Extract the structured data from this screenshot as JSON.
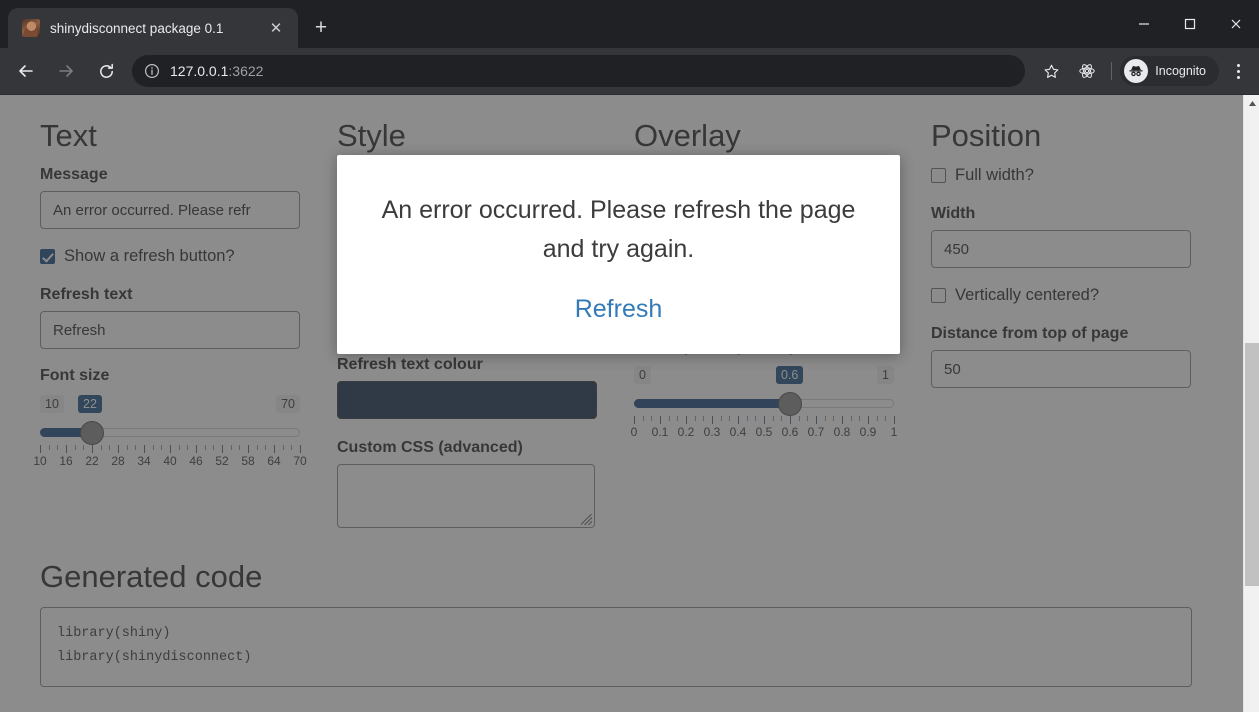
{
  "browser": {
    "tab": {
      "title": "shinydisconnect package 0.1",
      "favicon_name": "profile-photo-favicon",
      "close_label": "✕"
    },
    "new_tab_label": "+",
    "window_controls": {
      "minimize": "minimize",
      "maximize": "maximize",
      "close": "close"
    },
    "nav": {
      "back": "back",
      "forward": "forward",
      "reload": "reload"
    },
    "omnibox": {
      "host": "127.0.0.1",
      "port": ":3622",
      "site_info_icon": "info-circle-icon"
    },
    "toolbar": {
      "bookmark_icon": "star-icon",
      "extension_icon": "react-extension-icon",
      "incognito_label": "Incognito",
      "menu_icon": "kebab-menu-icon"
    }
  },
  "page": {
    "columns": {
      "text": {
        "heading": "Text",
        "message_label": "Message",
        "message_value": "An error occurred. Please refr",
        "show_refresh_label": "Show a refresh button?",
        "show_refresh_checked": true,
        "refresh_text_label": "Refresh text",
        "refresh_text_value": "Refresh",
        "font_size_label": "Font size"
      },
      "style": {
        "heading": "Style",
        "refresh_colour_label": "Refresh text colour",
        "refresh_colour_value": "#1a3450",
        "custom_css_label": "Custom CSS (advanced)",
        "custom_css_value": ""
      },
      "overlay": {
        "heading": "Overlay",
        "transparency_label": "Overlay transparency"
      },
      "position": {
        "heading": "Position",
        "full_width_label": "Full width?",
        "full_width_checked": false,
        "width_label": "Width",
        "width_value": "450",
        "vertically_centered_label": "Vertically centered?",
        "vertically_centered_checked": false,
        "distance_top_label": "Distance from top of page",
        "distance_top_value": "50"
      }
    },
    "generated_code": {
      "heading": "Generated code",
      "code": "library(shiny)\nlibrary(shinydisconnect)"
    }
  },
  "modal": {
    "message": "An error occurred. Please refresh the page and try again.",
    "refresh_label": "Refresh",
    "link_color": "#337ab7"
  },
  "chart_data": {
    "type": "slider-scales",
    "sliders": [
      {
        "name": "font-size",
        "label": "Font size",
        "min": 10,
        "max": 70,
        "value": 22,
        "tick_labels": [
          10,
          16,
          22,
          28,
          34,
          40,
          46,
          52,
          58,
          64,
          70
        ],
        "minor_ticks_per_major": 2
      },
      {
        "name": "overlay-transparency",
        "label": "Overlay transparency",
        "min": 0,
        "max": 1,
        "value": 0.6,
        "tick_labels": [
          0,
          0.1,
          0.2,
          0.3,
          0.4,
          0.5,
          0.6,
          0.7,
          0.8,
          0.9,
          1
        ],
        "minor_ticks_per_major": 2
      }
    ]
  },
  "scrollbar": {
    "up_arrow": "scroll-up-arrow",
    "thumb": "scroll-thumb"
  }
}
